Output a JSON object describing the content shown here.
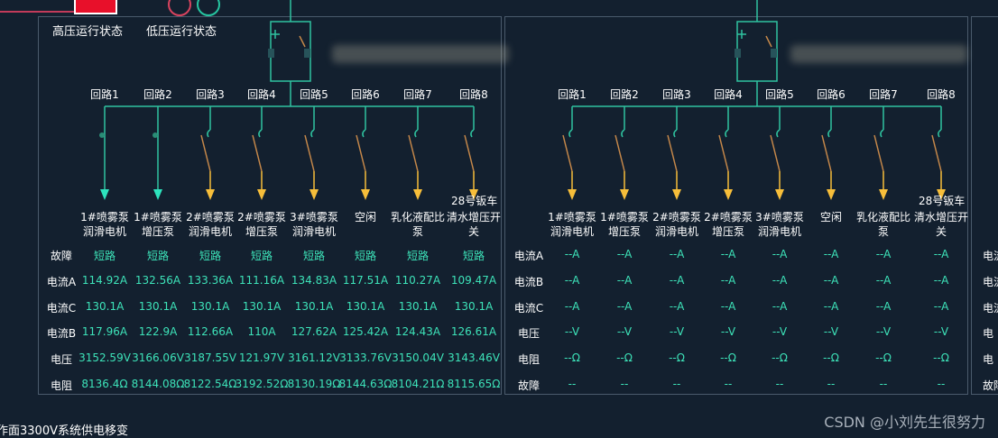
{
  "legend": {
    "high_label": "高压运行状态",
    "low_label": "低压运行状态",
    "colors": {
      "high": "#e8102a",
      "low_circle1": "#d8435e",
      "low_circle2": "#26c5a0"
    }
  },
  "colors": {
    "background": "#13202f",
    "line": "#2fc3a0",
    "teal_arrow": "#2de3bd",
    "yellow_arrow": "#f7be3a",
    "value": "#3de3b9",
    "switch_open": "#c6884a"
  },
  "left_panel": {
    "circuits": [
      "回路1",
      "回路2",
      "回路3",
      "回路4",
      "回路5",
      "回路6",
      "回路7",
      "回路8"
    ],
    "extra_label": "28号钣车",
    "devices": [
      "1#喷雾泵\n润滑电机",
      "1#喷雾泵\n增压泵",
      "2#喷雾泵\n润滑电机",
      "2#喷雾泵\n增压泵",
      "3#喷雾泵\n润滑电机",
      "空闲",
      "乳化液配比\n泵",
      "清水增压开\n关"
    ],
    "rows": [
      {
        "label": "故障",
        "values": [
          "短路",
          "短路",
          "短路",
          "短路",
          "短路",
          "短路",
          "短路",
          "短路"
        ]
      },
      {
        "label": "电流A",
        "values": [
          "114.92A",
          "132.56A",
          "133.36A",
          "111.16A",
          "134.83A",
          "117.51A",
          "110.27A",
          "109.47A"
        ]
      },
      {
        "label": "电流C",
        "values": [
          "130.1A",
          "130.1A",
          "130.1A",
          "130.1A",
          "130.1A",
          "130.1A",
          "130.1A",
          "130.1A"
        ]
      },
      {
        "label": "电流B",
        "values": [
          "117.96A",
          "122.9A",
          "112.66A",
          "110A",
          "127.62A",
          "125.42A",
          "124.43A",
          "126.61A"
        ]
      },
      {
        "label": "电压",
        "values": [
          "3152.59V",
          "3166.06V",
          "3187.55V",
          "121.97V",
          "3161.12V",
          "3133.76V",
          "3150.04V",
          "3143.46V"
        ]
      },
      {
        "label": "电阻",
        "values": [
          "8136.4Ω",
          "8144.08Ω",
          "8122.54Ω",
          "3192.52Ω",
          "8130.19Ω",
          "8144.63Ω",
          "8104.21Ω",
          "8115.65Ω"
        ]
      }
    ]
  },
  "right_panel": {
    "circuits": [
      "回路1",
      "回路2",
      "回路3",
      "回路4",
      "回路5",
      "回路6",
      "回路7",
      "回路8"
    ],
    "extra_label": "28号钣车",
    "devices": [
      "1#喷雾泵\n润滑电机",
      "1#喷雾泵\n增压泵",
      "2#喷雾泵\n润滑电机",
      "2#喷雾泵\n增压泵",
      "3#喷雾泵\n润滑电机",
      "空闲",
      "乳化液配比\n泵",
      "清水增压开\n关"
    ],
    "rows": [
      {
        "label": "电流A",
        "values": [
          "--A",
          "--A",
          "--A",
          "--A",
          "--A",
          "--A",
          "--A",
          "--A"
        ]
      },
      {
        "label": "电流B",
        "values": [
          "--A",
          "--A",
          "--A",
          "--A",
          "--A",
          "--A",
          "--A",
          "--A"
        ]
      },
      {
        "label": "电流C",
        "values": [
          "--A",
          "--A",
          "--A",
          "--A",
          "--A",
          "--A",
          "--A",
          "--A"
        ]
      },
      {
        "label": "电压",
        "values": [
          "--V",
          "--V",
          "--V",
          "--V",
          "--V",
          "--V",
          "--V",
          "--V"
        ]
      },
      {
        "label": "电阻",
        "values": [
          "--Ω",
          "--Ω",
          "--Ω",
          "--Ω",
          "--Ω",
          "--Ω",
          "--Ω",
          "--Ω"
        ]
      },
      {
        "label": "故障",
        "values": [
          "--",
          "--",
          "--",
          "--",
          "--",
          "--",
          "--",
          "--"
        ]
      }
    ]
  },
  "third_panel": {
    "row_labels": [
      "电流",
      "电流",
      "电流",
      "电",
      "电",
      "故障"
    ]
  },
  "footer": "作面3300V系统供电移变",
  "watermark": "CSDN @小刘先生很努力"
}
